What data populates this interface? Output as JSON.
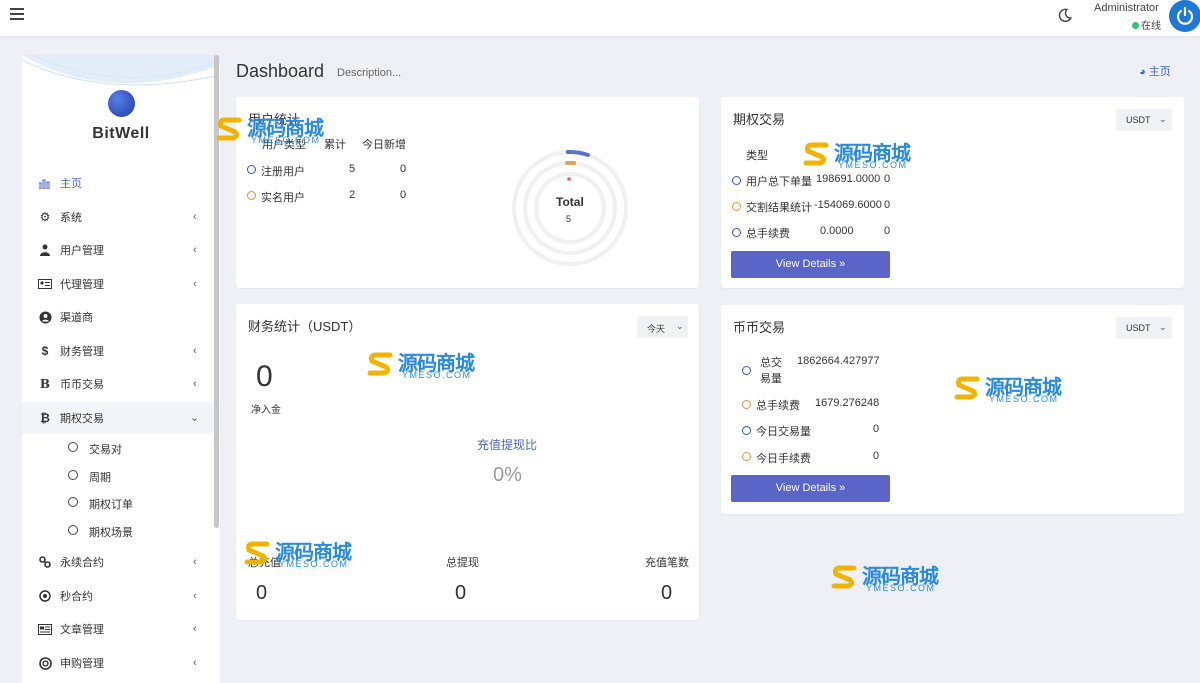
{
  "topbar": {
    "user_name": "Administrator",
    "user_status": "在线",
    "icons": [
      "hamburger-icon",
      "moon-icon",
      "power-icon"
    ]
  },
  "sidebar": {
    "brand": "BitWell",
    "items": [
      {
        "label": "主页",
        "icon": "bar-chart-icon",
        "active": true
      },
      {
        "label": "系统",
        "icon": "gear-icon"
      },
      {
        "label": "用户管理",
        "icon": "user-tie-icon"
      },
      {
        "label": "代理管理",
        "icon": "id-card-icon"
      },
      {
        "label": "渠道商",
        "icon": "user-circle-icon"
      },
      {
        "label": "财务管理",
        "icon": "dollar-icon"
      },
      {
        "label": "币币交易",
        "icon": "bitcoin-icon"
      },
      {
        "label": "期权交易",
        "icon": "bitcoin-icon",
        "open": true
      },
      {
        "label": "永续合约",
        "icon": "link-icon"
      },
      {
        "label": "秒合约",
        "icon": "dot-circle-icon"
      },
      {
        "label": "文章管理",
        "icon": "newspaper-icon"
      },
      {
        "label": "申购管理",
        "icon": "life-ring-icon"
      }
    ],
    "sub_items": [
      {
        "label": "交易对"
      },
      {
        "label": "周期"
      },
      {
        "label": "期权订单"
      },
      {
        "label": "期权场景"
      }
    ]
  },
  "header": {
    "title": "Dashboard",
    "description": "Description...",
    "breadcrumb": "主页"
  },
  "user_stats": {
    "title": "用户统计",
    "columns": [
      "用户类型",
      "累计",
      "今日新增"
    ],
    "rows": [
      {
        "type": "注册用户",
        "total": "5",
        "today": "0",
        "color": "#3a52b8"
      },
      {
        "type": "实名用户",
        "total": "2",
        "today": "0",
        "color": "#d9962e"
      }
    ],
    "donut_label": "Total",
    "donut_value": "5"
  },
  "option_trade": {
    "title": "期权交易",
    "currency": "USDT",
    "col_type": "类型",
    "rows": [
      {
        "label": "用户总下单量",
        "value": "198691.0000",
        "extra": "0",
        "color": "#3a52b8"
      },
      {
        "label": "交割结果统计",
        "value": "-154069.6000",
        "extra": "0",
        "color": "#d9962e"
      },
      {
        "label": "总手续费",
        "value": "0.0000",
        "extra": "0",
        "color": "#3a52b8"
      }
    ],
    "button": "View Details »"
  },
  "finance": {
    "title": "财务统计（USDT）",
    "period": "今天",
    "net_value": "0",
    "net_label": "净入金",
    "ratio_label": "充值提现比",
    "ratio_value": "0%",
    "bottom": [
      {
        "label": "总充值",
        "value": "0"
      },
      {
        "label": "总提现",
        "value": "0"
      },
      {
        "label": "充值笔数",
        "value": "0"
      }
    ]
  },
  "coin_trade": {
    "title": "币币交易",
    "currency": "USDT",
    "rows": [
      {
        "label": "总交易量",
        "value": "1862664.427977",
        "extra": "",
        "color": "#3a52b8"
      },
      {
        "label": "总手续费",
        "value": "1679.276248",
        "extra": "",
        "color": "#d9962e"
      },
      {
        "label": "今日交易量",
        "value": "",
        "extra": "0",
        "color": "#3a52b8"
      },
      {
        "label": "今日手续费",
        "value": "",
        "extra": "0",
        "color": "#d9962e"
      }
    ],
    "button": "View Details »"
  },
  "watermark": {
    "text": "源码商城",
    "sub": "YMESO.COM"
  }
}
